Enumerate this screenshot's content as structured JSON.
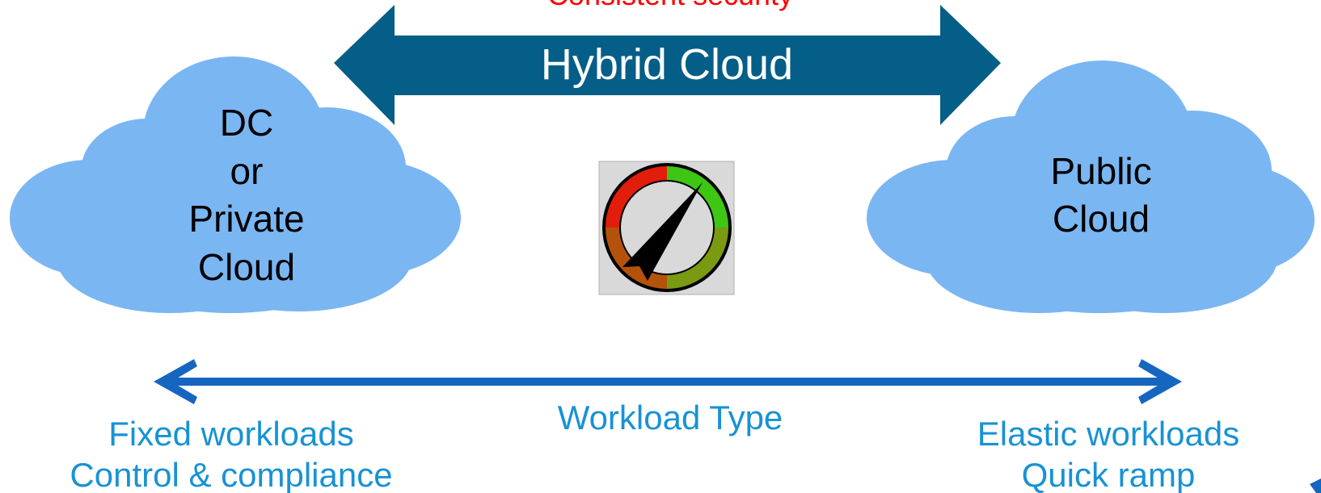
{
  "banner": {
    "top_text": "Consistent security",
    "title": "Hybrid Cloud"
  },
  "left_cloud": {
    "lines": [
      "DC",
      "or",
      "Private",
      "Cloud"
    ]
  },
  "right_cloud": {
    "lines": [
      "Public",
      "Cloud"
    ]
  },
  "gauge": {
    "icon": "gauge-dial-icon",
    "colors": [
      "#e21d0b",
      "#3ec614",
      "#d9d9d9"
    ]
  },
  "workload_axis": {
    "center_label": "Workload Type",
    "left_labels": [
      "Fixed workloads",
      "Control & compliance"
    ],
    "right_labels": [
      "Elastic workloads",
      "Quick ramp"
    ]
  },
  "colors": {
    "cloud": "#7ab6f2",
    "banner_arrow": "#055e87",
    "axis_arrow": "#1666c0",
    "blue_text": "#1892d4",
    "red_text": "#ff0000"
  }
}
